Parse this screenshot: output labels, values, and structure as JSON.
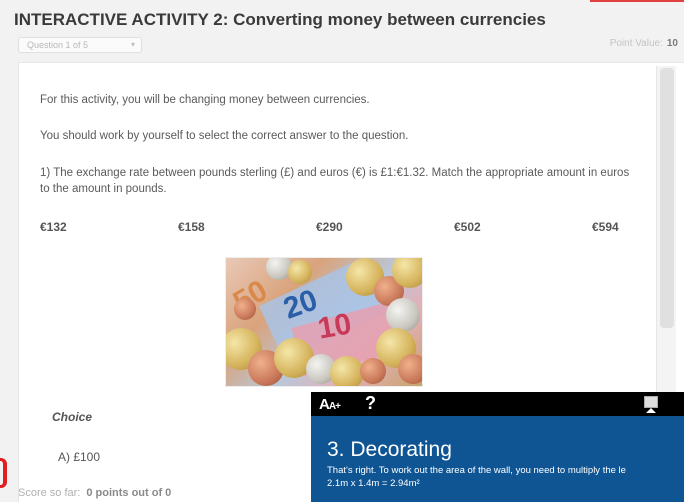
{
  "header": {
    "title": "INTERACTIVE ACTIVITY 2: Converting money between currencies",
    "question_selector": "Question 1 of 5",
    "point_value_label": "Point Value:",
    "point_value": "10"
  },
  "content": {
    "intro": "For this activity, you will be changing money between currencies.",
    "instruction": "You should work by yourself to select the correct answer to the question.",
    "question": "1) The exchange rate between pounds sterling (£) and euros (€) is £1:€1.32. Match the appropriate amount in euros to the amount in pounds.",
    "amounts": [
      "€132",
      "€158",
      "€290",
      "€502",
      "€594"
    ],
    "choice_header": "Choice",
    "choice_a": "A) £100"
  },
  "image": {
    "note_numbers": [
      "50",
      "20",
      "10"
    ]
  },
  "footer": {
    "score_label": "Score so far:",
    "score_value": "0 points out of 0"
  },
  "overlay": {
    "font_size_label": "A",
    "font_size_small": "A+",
    "help_label": "?",
    "heading": "3. Decorating",
    "text": "That's right. To work out the area of the wall, you need to multiply the le",
    "calc": "2.1m x 1.4m = 2.94m²"
  },
  "colors": {
    "overlay_bg": "#0f5594",
    "overlay_bar": "#000000",
    "accent_red": "#e02020"
  },
  "icons": [
    "caret-down-icon",
    "font-size-icon",
    "help-icon",
    "notes-icon"
  ]
}
